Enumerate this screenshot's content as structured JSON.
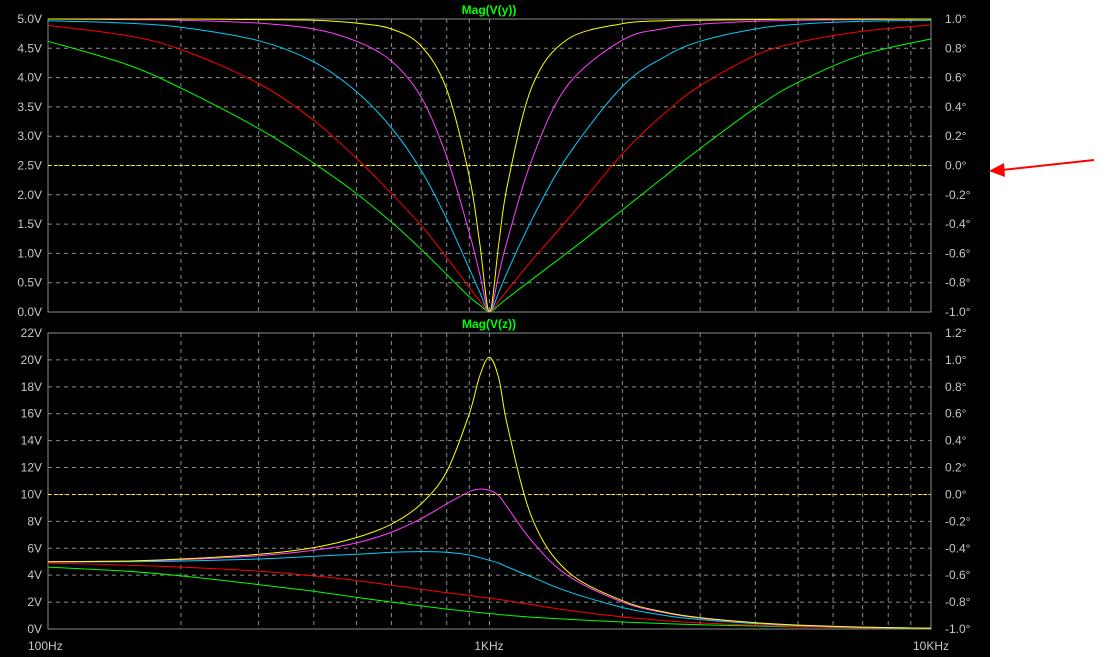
{
  "colors": {
    "background": "#000000",
    "axis_text": "#c8c8c8",
    "title_text": "#00ff00",
    "grid": "#8c8c8c",
    "right_axis_zero": "#ffff00",
    "arrow": "#ff0000",
    "series": [
      "#00ff00",
      "#ff0000",
      "#00d0ff",
      "#ff40ff",
      "#ffff00"
    ]
  },
  "chart_data": [
    {
      "type": "line",
      "title": "Mag(V(y))",
      "x_scale": "log",
      "x_ticks": [
        "100Hz",
        "1KHz",
        "10KHz"
      ],
      "xlim": [
        100,
        10000
      ],
      "ylim": [
        0,
        5
      ],
      "y_ticks": [
        "0.0V",
        "0.5V",
        "1.0V",
        "1.5V",
        "2.0V",
        "2.5V",
        "3.0V",
        "3.5V",
        "4.0V",
        "4.5V",
        "5.0V"
      ],
      "right_ylim": [
        -1,
        1
      ],
      "right_y_ticks": [
        "-1.0°",
        "-0.8°",
        "-0.6°",
        "-0.4°",
        "-0.2°",
        "0.0°",
        "0.2°",
        "0.4°",
        "0.6°",
        "0.8°",
        "1.0°"
      ],
      "right_zero_line": 0,
      "x": [
        100,
        150,
        200,
        300,
        400,
        500,
        600,
        700,
        800,
        900,
        950,
        1000,
        1050,
        1100,
        1250,
        1500,
        2000,
        2500,
        3000,
        4000,
        5000,
        7000,
        10000
      ],
      "series": [
        {
          "values": [
            4.62,
            4.23,
            3.82,
            3.13,
            2.54,
            2.02,
            1.53,
            1.07,
            0.64,
            0.26,
            0.12,
            0.0,
            0.12,
            0.24,
            0.56,
            1.01,
            1.74,
            2.32,
            2.79,
            3.48,
            3.92,
            4.39,
            4.66
          ]
        },
        {
          "values": [
            4.89,
            4.72,
            4.48,
            3.9,
            3.27,
            2.62,
            2.02,
            1.48,
            0.93,
            0.42,
            0.19,
            0.0,
            0.19,
            0.38,
            0.89,
            1.57,
            2.7,
            3.4,
            3.86,
            4.38,
            4.6,
            4.79,
            4.9
          ]
        },
        {
          "values": [
            4.97,
            4.93,
            4.86,
            4.63,
            4.27,
            3.76,
            3.14,
            2.42,
            1.59,
            0.74,
            0.34,
            0.0,
            0.34,
            0.7,
            1.59,
            2.65,
            3.85,
            4.36,
            4.62,
            4.83,
            4.91,
            4.96,
            4.98
          ]
        },
        {
          "values": [
            5.0,
            4.99,
            4.98,
            4.93,
            4.83,
            4.62,
            4.28,
            3.67,
            2.65,
            1.35,
            0.65,
            0.0,
            0.65,
            1.25,
            2.62,
            3.86,
            4.64,
            4.84,
            4.91,
            4.96,
            4.98,
            4.99,
            5.0
          ]
        },
        {
          "values": [
            5.0,
            5.0,
            5.0,
            4.99,
            4.98,
            4.93,
            4.83,
            4.54,
            3.8,
            2.31,
            1.18,
            0.0,
            1.18,
            2.2,
            3.86,
            4.65,
            4.92,
            4.97,
            4.98,
            4.99,
            5.0,
            5.0,
            5.0
          ]
        }
      ]
    },
    {
      "type": "line",
      "title": "Mag(V(z))",
      "x_scale": "log",
      "x_ticks": [
        "100Hz",
        "1KHz",
        "10KHz"
      ],
      "xlim": [
        100,
        10000
      ],
      "ylim": [
        0,
        22
      ],
      "y_ticks": [
        "0V",
        "2V",
        "4V",
        "6V",
        "8V",
        "10V",
        "12V",
        "14V",
        "16V",
        "18V",
        "20V",
        "22V"
      ],
      "right_ylim": [
        -1,
        1.2
      ],
      "right_y_ticks": [
        "-1.0°",
        "-0.8°",
        "-0.6°",
        "-0.4°",
        "-0.2°",
        "0.0°",
        "0.2°",
        "0.4°",
        "0.6°",
        "0.8°",
        "1.0°",
        "1.2°"
      ],
      "right_zero_line": 0,
      "x": [
        100,
        150,
        200,
        300,
        400,
        500,
        600,
        700,
        800,
        900,
        950,
        1000,
        1050,
        1100,
        1250,
        1500,
        2000,
        2500,
        3000,
        4000,
        5000,
        7000,
        10000
      ],
      "series": [
        {
          "values": [
            4.6,
            4.3,
            3.95,
            3.3,
            2.8,
            2.35,
            2.0,
            1.72,
            1.48,
            1.3,
            1.22,
            1.15,
            1.08,
            1.02,
            0.88,
            0.72,
            0.52,
            0.4,
            0.32,
            0.22,
            0.16,
            0.09,
            0.05
          ]
        },
        {
          "values": [
            4.9,
            4.75,
            4.6,
            4.3,
            3.95,
            3.6,
            3.25,
            2.95,
            2.7,
            2.5,
            2.38,
            2.3,
            2.2,
            2.1,
            1.8,
            1.4,
            0.9,
            0.62,
            0.45,
            0.28,
            0.18,
            0.1,
            0.05
          ]
        },
        {
          "values": [
            4.98,
            5.0,
            5.05,
            5.2,
            5.4,
            5.55,
            5.7,
            5.75,
            5.7,
            5.5,
            5.3,
            5.1,
            4.9,
            4.6,
            3.85,
            2.8,
            1.6,
            1.0,
            0.7,
            0.4,
            0.25,
            0.12,
            0.06
          ]
        },
        {
          "values": [
            5.0,
            5.05,
            5.15,
            5.45,
            5.85,
            6.4,
            7.2,
            8.2,
            9.3,
            10.2,
            10.4,
            10.3,
            9.9,
            9.0,
            6.5,
            4.0,
            2.0,
            1.2,
            0.8,
            0.45,
            0.28,
            0.13,
            0.06
          ]
        },
        {
          "values": [
            5.0,
            5.05,
            5.2,
            5.55,
            6.05,
            6.8,
            7.8,
            9.3,
            11.7,
            16.0,
            18.8,
            20.2,
            18.6,
            15.0,
            8.2,
            4.3,
            2.1,
            1.25,
            0.85,
            0.47,
            0.29,
            0.14,
            0.06
          ]
        }
      ]
    }
  ]
}
